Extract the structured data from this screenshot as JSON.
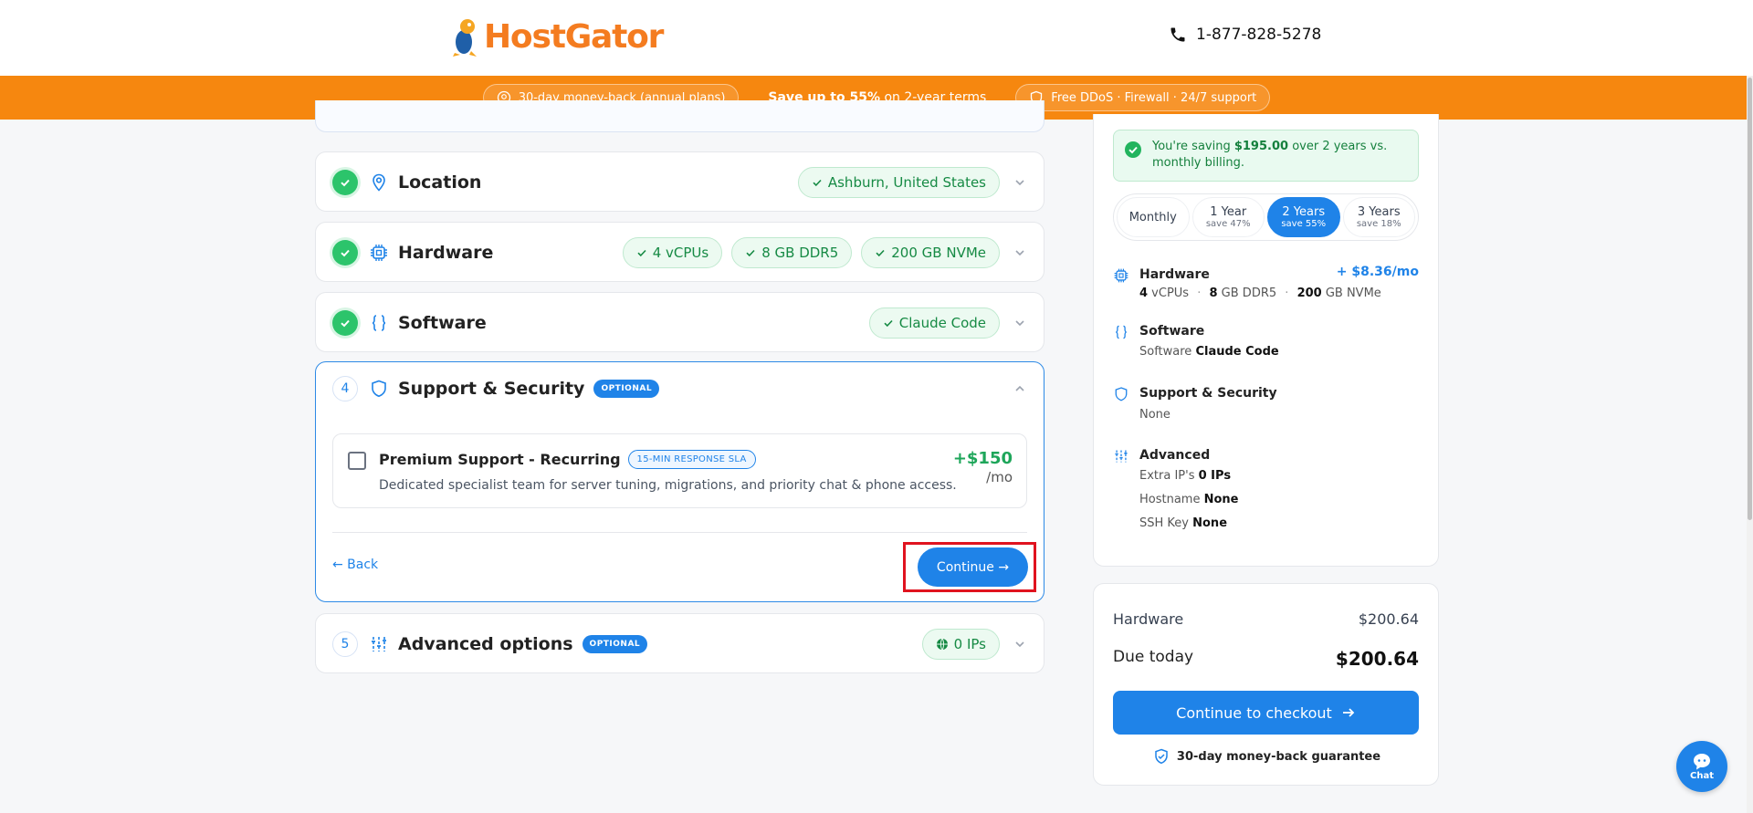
{
  "header": {
    "logo_text": "HostGator",
    "phone": "1-877-828-5278"
  },
  "banner": {
    "left_pill": "30-day money-back (annual plans)",
    "mid_bold": "Save up to 55%",
    "mid_rest": " on 2-year terms",
    "right_pill": "Free DDoS · Firewall · 24/7 support"
  },
  "steps": {
    "location": {
      "title": "Location",
      "chips": [
        "Ashburn, United States"
      ]
    },
    "hardware": {
      "title": "Hardware",
      "chips": [
        "4 vCPUs",
        "8 GB DDR5",
        "200 GB NVMe"
      ]
    },
    "software": {
      "title": "Software",
      "chips": [
        "Claude Code"
      ]
    },
    "support": {
      "number": "4",
      "title": "Support & Security",
      "badge": "OPTIONAL",
      "addon": {
        "title": "Premium Support - Recurring",
        "sla": "15-MIN RESPONSE SLA",
        "desc": "Dedicated specialist team for server tuning, migrations, and priority chat & phone access.",
        "price": "+$150",
        "per": "/mo",
        "checked": false
      },
      "back": "← Back",
      "continue": "Continue →"
    },
    "advanced": {
      "number": "5",
      "title": "Advanced options",
      "badge": "OPTIONAL",
      "chip": "0 IPs"
    }
  },
  "summary": {
    "saving_pre": "You're saving ",
    "saving_amount": "$195.00",
    "saving_post": " over 2 years vs. monthly billing.",
    "terms": [
      {
        "label": "Monthly",
        "sub": ""
      },
      {
        "label": "1 Year",
        "sub": "save 47%"
      },
      {
        "label": "2 Years",
        "sub": "save 55%"
      },
      {
        "label": "3 Years",
        "sub": "save 18%"
      }
    ],
    "selected_term": "2 Years",
    "hardware": {
      "title": "Hardware",
      "price": "+ $8.36/mo",
      "cpu_val": "4",
      "cpu_unit": " vCPUs",
      "ram_val": "8",
      "ram_unit": " GB DDR5",
      "disk_val": "200",
      "disk_unit": " GB NVMe",
      "sep": "·"
    },
    "software": {
      "title": "Software",
      "label": "Software ",
      "value": "Claude Code"
    },
    "support": {
      "title": "Support & Security",
      "value": "None"
    },
    "advanced": {
      "title": "Advanced",
      "ips_label": "Extra IP's ",
      "ips_value": "0 IPs",
      "host_label": "Hostname ",
      "host_value": "None",
      "ssh_label": "SSH Key ",
      "ssh_value": "None"
    }
  },
  "totals": {
    "hardware_label": "Hardware",
    "hardware_value": "$200.64",
    "due_label": "Due today",
    "due_value": "$200.64",
    "checkout": "Continue to checkout",
    "guarantee": "30-day money-back guarantee"
  },
  "chat": {
    "label": "Chat"
  },
  "colors": {
    "brand_orange": "#f47c20",
    "banner": "#f6870f",
    "primary": "#1f83e8",
    "success": "#2cc46b",
    "highlight": "#e0131f"
  }
}
